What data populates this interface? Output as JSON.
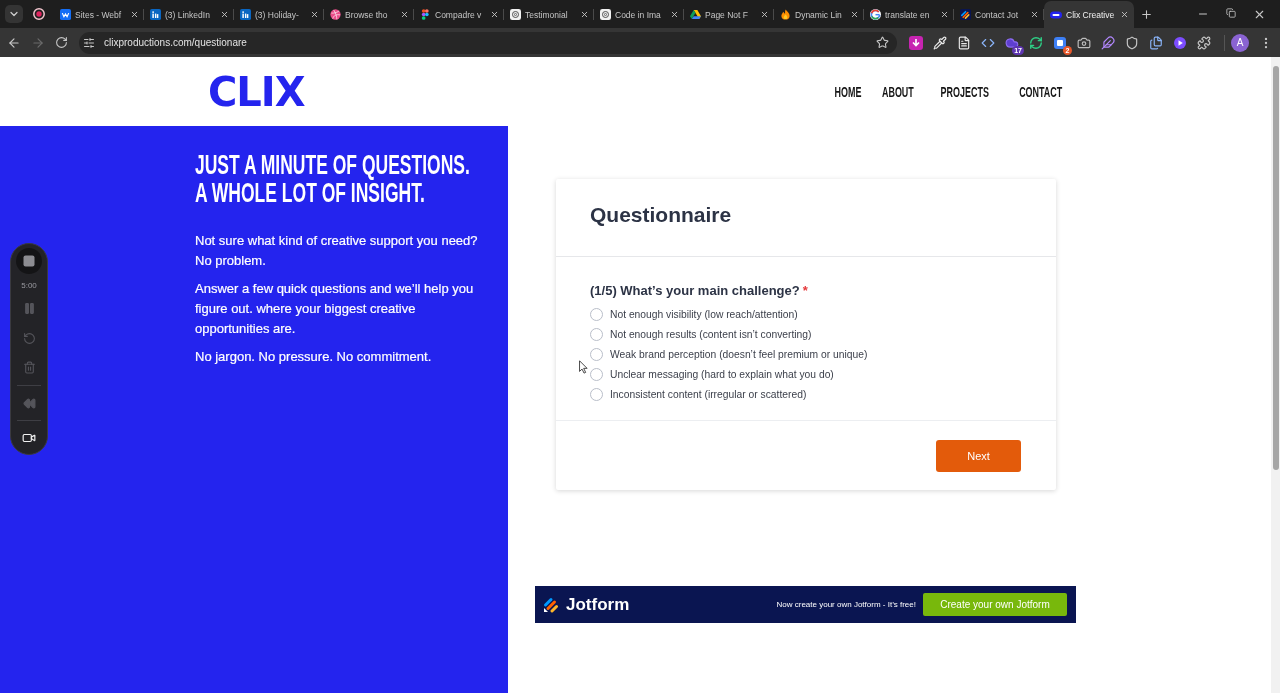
{
  "browser": {
    "tabs": [
      {
        "title": "Sites - Webf",
        "selected": false
      },
      {
        "title": "(3) LinkedIn",
        "selected": false
      },
      {
        "title": "(3) Holiday-",
        "selected": false
      },
      {
        "title": "Browse tho",
        "selected": false
      },
      {
        "title": "Compadre v",
        "selected": false
      },
      {
        "title": "Testimonial",
        "selected": false
      },
      {
        "title": "Code in Ima",
        "selected": false
      },
      {
        "title": "Page Not F",
        "selected": false
      },
      {
        "title": "Dynamic Lin",
        "selected": false
      },
      {
        "title": "translate en",
        "selected": false
      },
      {
        "title": "Contact Jot",
        "selected": false
      },
      {
        "title": "Clix Creative",
        "selected": true
      }
    ],
    "forward_disabled": true,
    "address": "clixproductions.com/questionare",
    "extension_badges": [
      "17",
      "2"
    ],
    "profile_initial": "A"
  },
  "recorder": {
    "timer": "5:00"
  },
  "site": {
    "logo": "CLIX",
    "nav": [
      "HOME",
      "ABOUT",
      "PROJECTS",
      "CONTACT"
    ]
  },
  "intro": {
    "headline_lines": [
      "JUST A MINUTE OF QUESTIONS.",
      "A WHOLE LOT OF INSIGHT."
    ],
    "paragraphs": [
      "Not sure what kind of creative support you need? No problem.",
      "Answer a few quick questions and we’ll help you figure out. where your biggest creative opportunities are.",
      "No jargon. No pressure. No commitment."
    ]
  },
  "form": {
    "title": "Questionnaire",
    "question": "(1/5) What’s your main challenge?",
    "required_mark": "*",
    "options": [
      {
        "label": "Not enough visibility (low reach/attention)",
        "selected": false
      },
      {
        "label": "Not enough results (content isn’t converting)",
        "selected": false
      },
      {
        "label": "Weak brand perception (doesn’t feel premium or unique)",
        "selected": false
      },
      {
        "label": "Unclear messaging (hard to explain what you do)",
        "selected": false
      },
      {
        "label": "Inconsistent content (irregular or scattered)",
        "selected": false
      }
    ],
    "next_button": "Next"
  },
  "jotform_banner": {
    "brand": "Jotform",
    "tagline": "Now create your own Jotform - It’s free!",
    "button": "Create your own Jotform"
  }
}
